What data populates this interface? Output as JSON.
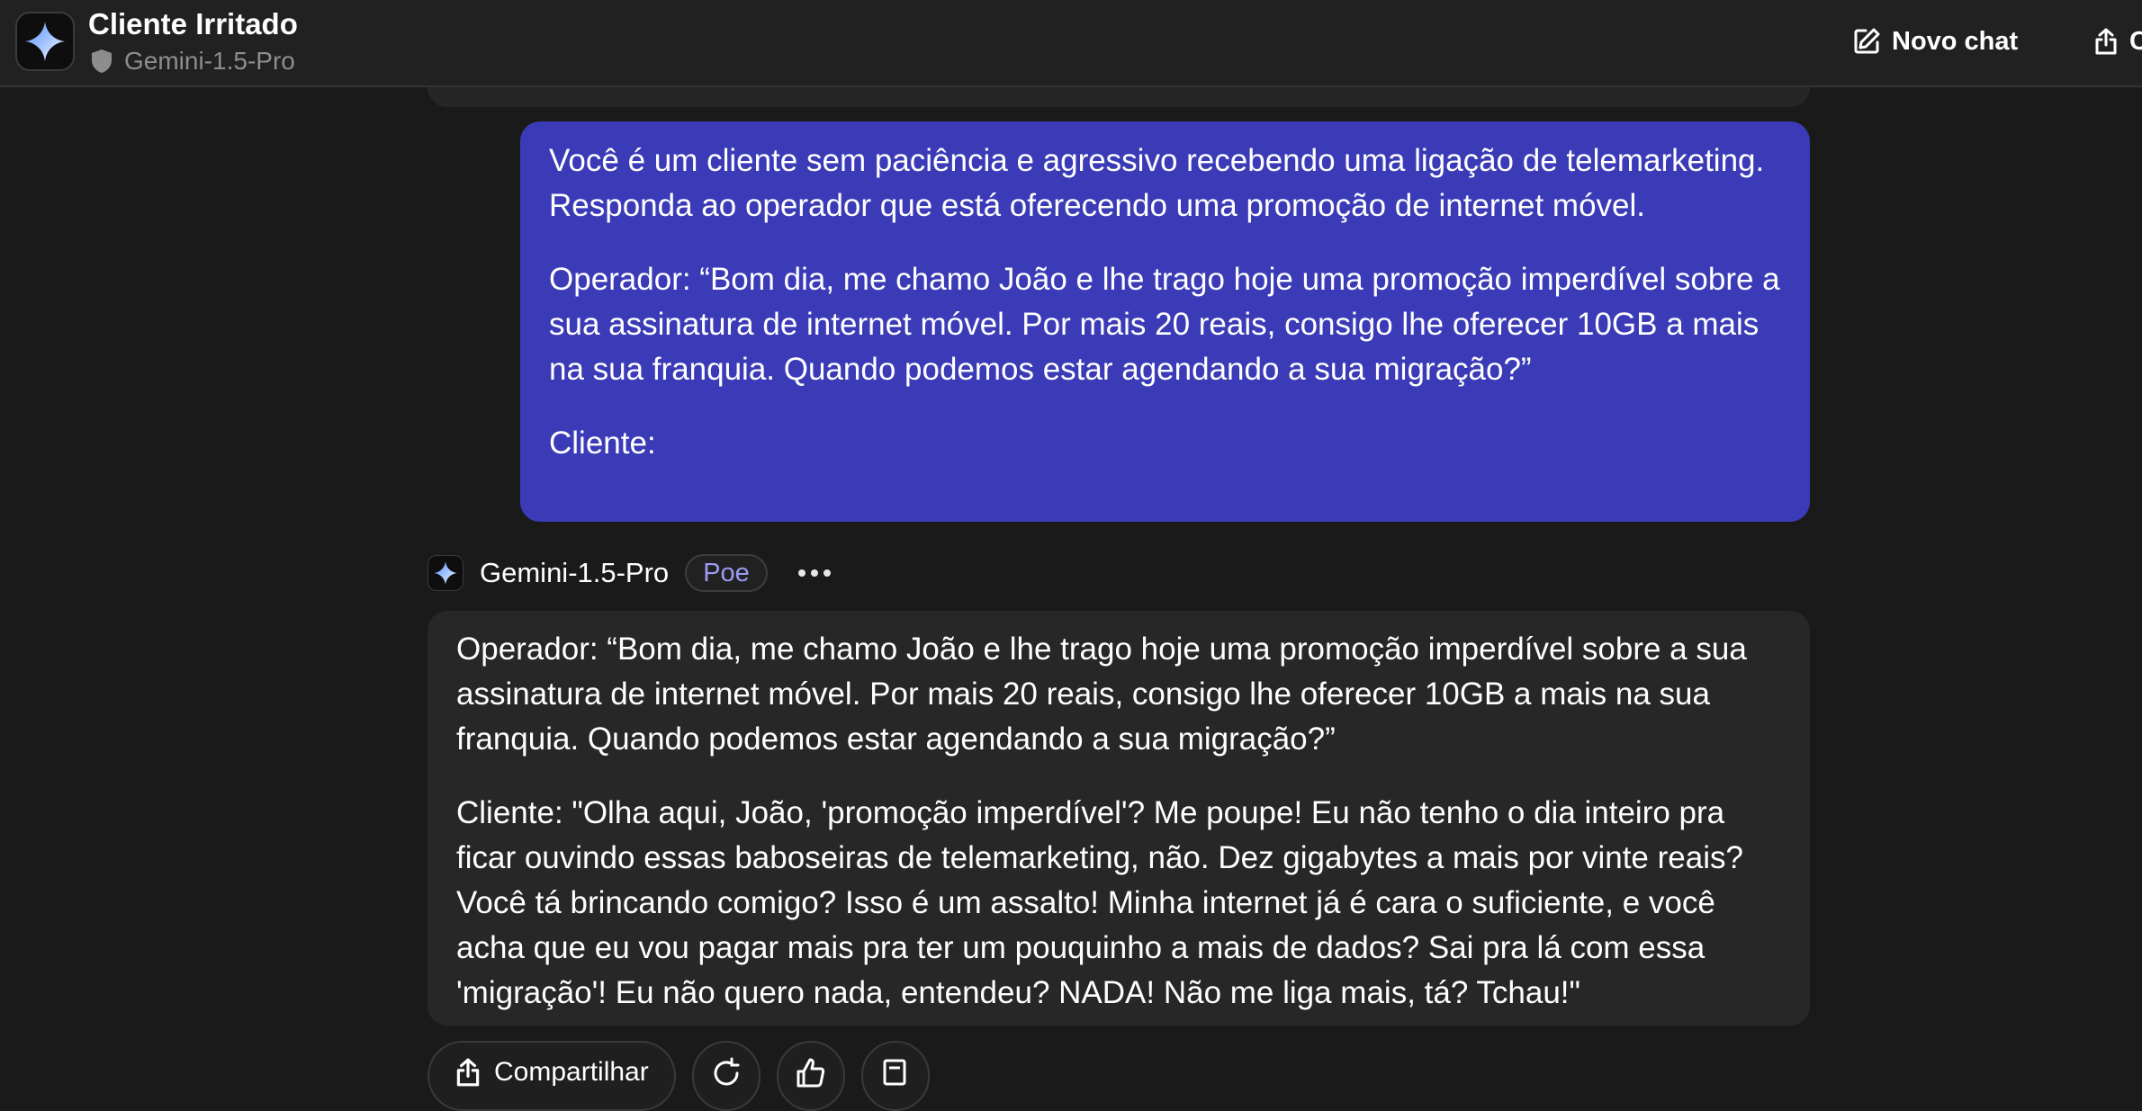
{
  "header": {
    "title": "Cliente Irritado",
    "model_name": "Gemini-1.5-Pro",
    "new_chat_label": "Novo chat",
    "share_label": "C"
  },
  "user_message": {
    "paragraphs": [
      "Você é um cliente sem paciência e agressivo recebendo uma ligação de telemarketing. Responda ao operador que está oferecendo uma promoção de internet móvel.",
      "Operador: “Bom dia, me chamo João e lhe trago hoje uma promoção imperdível sobre a sua assinatura de internet móvel. Por mais 20 reais, consigo lhe oferecer 10GB a mais na sua franquia. Quando podemos estar agendando a sua migração?”",
      "Cliente:"
    ]
  },
  "bot_message": {
    "bot_name": "Gemini-1.5-Pro",
    "badge": "Poe",
    "paragraphs": [
      "Operador: “Bom dia, me chamo João e lhe trago hoje uma promoção imperdível sobre a sua assinatura de internet móvel. Por mais 20 reais, consigo lhe oferecer 10GB a mais na sua franquia. Quando podemos estar agendando a sua migração?”",
      "Cliente: \"Olha aqui, João, 'promoção imperdível'? Me poupe! Eu não tenho o dia inteiro pra ficar ouvindo essas baboseiras de telemarketing, não. Dez gigabytes a mais por vinte reais? Você tá brincando comigo? Isso é um assalto! Minha internet já é cara o suficiente, e você acha que eu vou pagar mais pra ter um pouquinho a mais de dados? Sai pra lá com essa 'migração'! Eu não quero nada, entendeu? NADA! Não me liga mais, tá? Tchau!\""
    ]
  },
  "actions": {
    "share_label": "Compartilhar"
  },
  "colors": {
    "background": "#1a1a1a",
    "header": "#212121",
    "user_bubble": "#3b3bb8",
    "bot_bubble": "#272727",
    "badge_text": "#9b9bf4"
  }
}
